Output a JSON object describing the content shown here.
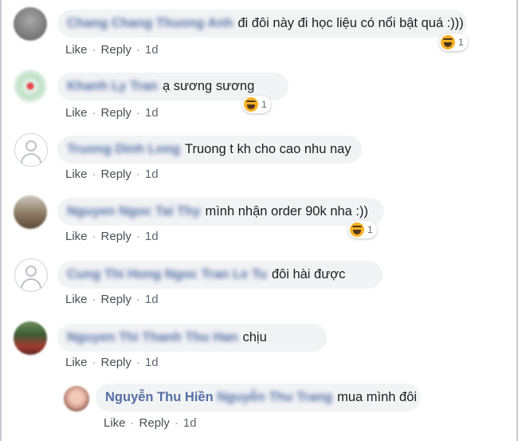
{
  "actions": {
    "like": "Like",
    "reply": "Reply",
    "dot": "·"
  },
  "comments": [
    {
      "name": "Chang Chang Thuong Anh",
      "text": "đi đôi này đi học liệu có nổi bật quá :)))",
      "time": "1d",
      "reaction": {
        "icon": "haha-icon",
        "count": "1"
      }
    },
    {
      "name": "Khanh Ly Tran",
      "text": "ạ sương sương",
      "time": "1d",
      "reaction": {
        "icon": "haha-icon",
        "count": "1"
      }
    },
    {
      "name": "Truong Dinh Long",
      "text": "Truong t kh cho cao nhu nay",
      "time": "1d"
    },
    {
      "name": "Nguyen Ngoc Tai Thy",
      "text": "mình nhận order 90k nha :))",
      "time": "1d",
      "reaction": {
        "icon": "haha-icon",
        "count": "1"
      }
    },
    {
      "name": "Cung Thi Hong Ngoc Tran Le Tu",
      "text": "đôi hài được",
      "time": "1d"
    },
    {
      "name": "Nguyen Thi Thanh Thu Han",
      "text": "chịu",
      "time": "1d"
    }
  ],
  "reply": {
    "name_clear": "Nguyễn Thu Hiền",
    "name_blur": "Nguyễn Thu Trang",
    "text": "mua mình đôi",
    "time": "1d"
  },
  "colors": {
    "name": "#385898",
    "bubble": "#f2f3f5",
    "haha": "#f7b125"
  }
}
